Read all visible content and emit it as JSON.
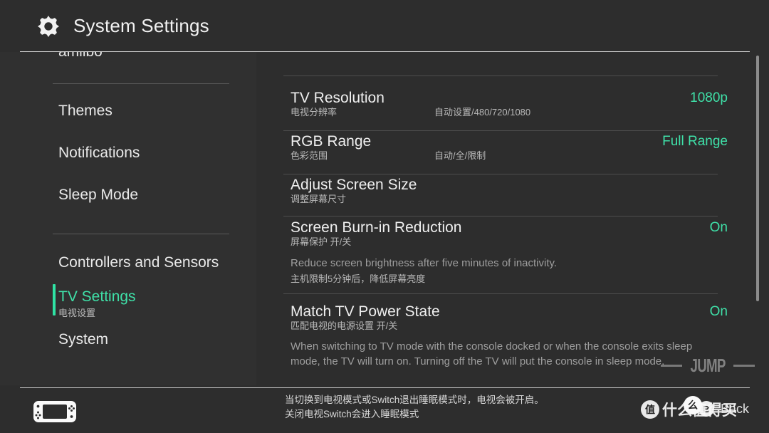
{
  "header": {
    "title": "System Settings",
    "icon": "gear-icon"
  },
  "sidebar": {
    "clipped_item": "amiibo",
    "items": [
      {
        "label": "Themes",
        "sub": "",
        "selected": false
      },
      {
        "label": "Notifications",
        "sub": "",
        "selected": false
      },
      {
        "label": "Sleep Mode",
        "sub": "",
        "selected": false
      },
      {
        "label": "Controllers and Sensors",
        "sub": "",
        "selected": false
      },
      {
        "label": "TV Settings",
        "sub": "电视设置",
        "selected": true
      },
      {
        "label": "System",
        "sub": "",
        "selected": false
      }
    ]
  },
  "content": {
    "rows": [
      {
        "title": "TV Resolution",
        "sub": "电视分辨率",
        "options": "自动设置/480/720/1080",
        "value": "1080p",
        "desc": "",
        "desc_cn": ""
      },
      {
        "title": "RGB Range",
        "sub": "色彩范围",
        "options": "自动/全/限制",
        "value": "Full Range",
        "desc": "",
        "desc_cn": ""
      },
      {
        "title": "Adjust Screen Size",
        "sub": "调整屏幕尺寸",
        "options": "",
        "value": "",
        "desc": "",
        "desc_cn": ""
      },
      {
        "title": "Screen Burn-in Reduction",
        "sub": "屏幕保护 开/关",
        "options": "",
        "value": "On",
        "desc": "Reduce screen brightness after five minutes of inactivity.",
        "desc_cn": "主机限制5分钟后，降低屏幕亮度"
      },
      {
        "title": "Match TV Power State",
        "sub": "匹配电视的电源设置 开/关",
        "options": "",
        "value": "On",
        "desc": "When switching to TV mode with the console docked or when the console exits sleep mode, the TV will turn on. Turning off the TV will put the console in sleep mode.",
        "desc_cn": ""
      }
    ]
  },
  "footer": {
    "device_icon": "switch-console-icon",
    "note_line1": "当切换到电视模式或Switch退出睡眠模式时，电视会被开启。",
    "note_line2": "关闭电视Switch会进入睡眠模式",
    "back_button_glyph": "B",
    "back_label": "Back"
  },
  "watermarks": {
    "jump": "JUMP",
    "smzdm_text": "什么值得买",
    "smzdm_mark": "值",
    "smzdm_badge": "么"
  },
  "scrollbar": {
    "position": "right"
  },
  "colors": {
    "accent": "#3fe0a8",
    "background": "#2d2d2d",
    "sidebar_background": "#303030",
    "text_primary": "#efefef",
    "text_secondary": "#b9b9b9",
    "divider": "#4d4d4d"
  }
}
